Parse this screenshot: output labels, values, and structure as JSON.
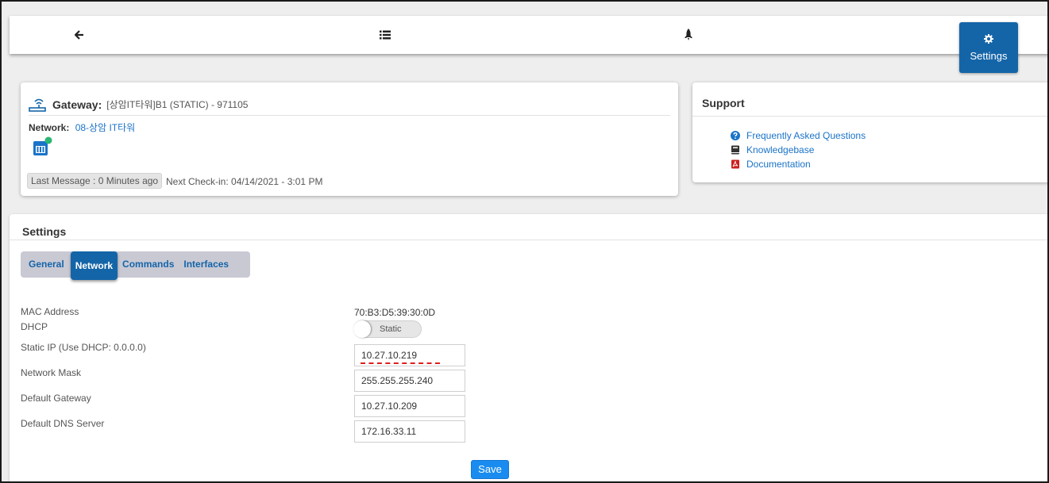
{
  "nav": {
    "settings_label": "Settings",
    "icons": [
      "arrow-left-icon",
      "list-icon",
      "rocket-icon",
      "gear-icon"
    ],
    "accent": "#1465a8"
  },
  "gateway": {
    "title": "Gateway:",
    "name": "[상암IT타워]B1 (STATIC) - 971105",
    "network_label": "Network:",
    "network_value": "08-상암 IT타워",
    "last_message": "Last Message : 0 Minutes ago",
    "next_checkin": "Next Check-in: 04/14/2021 - 3:01 PM",
    "status_dot_color": "#2bb673"
  },
  "support": {
    "title": "Support",
    "items": [
      {
        "label": "Frequently Asked Questions",
        "icon": "question-circle-icon"
      },
      {
        "label": "Knowledgebase",
        "icon": "book-icon"
      },
      {
        "label": "Documentation",
        "icon": "pdf-icon"
      }
    ]
  },
  "settings": {
    "title": "Settings",
    "tabs": [
      {
        "label": "General",
        "active": false
      },
      {
        "label": "Network",
        "active": true
      },
      {
        "label": "Commands",
        "active": false
      },
      {
        "label": "Interfaces",
        "active": false
      }
    ],
    "fields": {
      "mac_label": "MAC Address",
      "mac_value": "70:B3:D5:39:30:0D",
      "dhcp_label": "DHCP",
      "dhcp_toggle": "Static",
      "static_ip_label": "Static IP (Use DHCP: 0.0.0.0)",
      "static_ip_value": "10.27.10.219",
      "mask_label": "Network Mask",
      "mask_value": "255.255.255.240",
      "gateway_label": "Default Gateway",
      "gateway_value": "10.27.10.209",
      "dns_label": "Default DNS Server",
      "dns_value": "172.16.33.11"
    },
    "save_label": "Save"
  }
}
